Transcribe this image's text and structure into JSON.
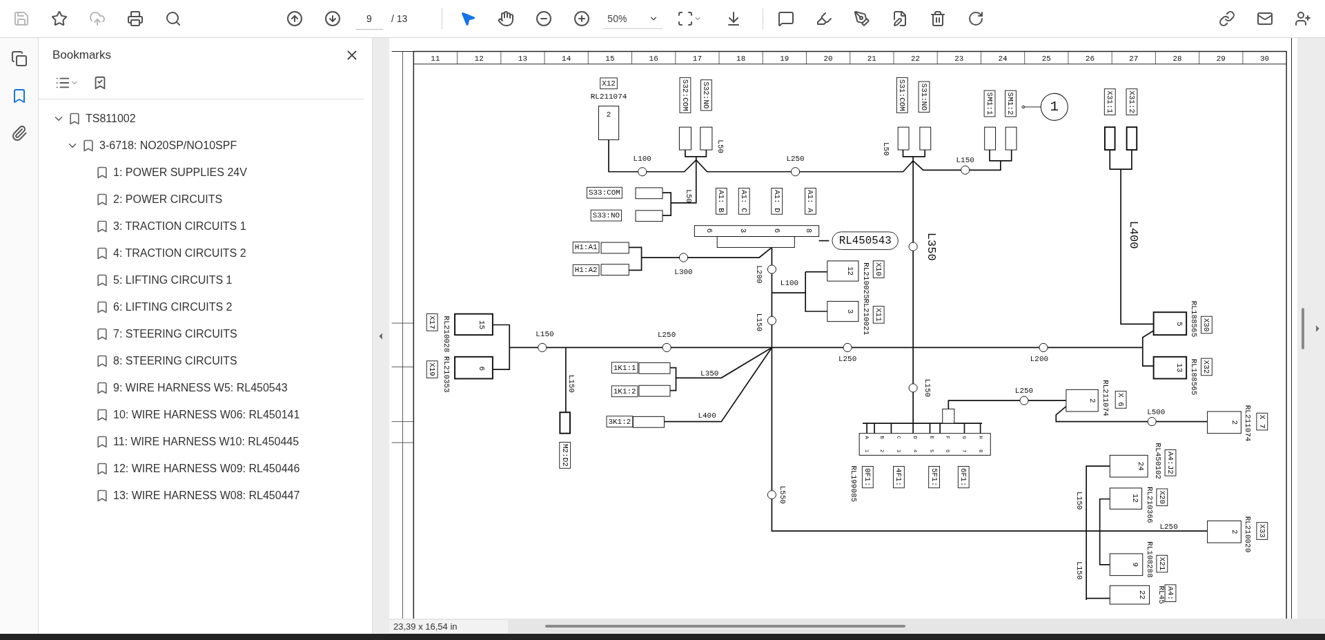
{
  "toolbar": {
    "page_number": "9",
    "page_total": "/ 13",
    "zoom": "50%"
  },
  "side_tabs": [
    {
      "kind": "pages",
      "selected": false
    },
    {
      "kind": "bookmarks",
      "selected": true
    },
    {
      "kind": "attachments",
      "selected": false
    }
  ],
  "bookmarks": {
    "title": "Bookmarks",
    "items": [
      {
        "label": "TS811002",
        "expanded": true,
        "children": [
          {
            "label": "3-6718: NO20SP/NO10SPF",
            "expanded": true,
            "children": [
              {
                "label": "1: POWER SUPPLIES 24V"
              },
              {
                "label": "2: POWER CIRCUITS"
              },
              {
                "label": "3: TRACTION CIRCUITS 1"
              },
              {
                "label": "4: TRACTION CIRCUITS 2"
              },
              {
                "label": "5: LIFTING CIRCUITS 1"
              },
              {
                "label": "6: LIFTING CIRCUITS 2"
              },
              {
                "label": "7: STEERING CIRCUITS"
              },
              {
                "label": "8: STEERING CIRCUITS"
              },
              {
                "label": "9: WIRE HARNESS W5: RL450543"
              },
              {
                "label": "10: WIRE HARNESS W06: RL450141"
              },
              {
                "label": "11: WIRE HARNESS W10: RL450445"
              },
              {
                "label": "12: WIRE HARNESS W09: RL450446"
              },
              {
                "label": "13: WIRE HARNESS W08: RL450447"
              }
            ]
          }
        ]
      }
    ]
  },
  "diagram": {
    "columns": [
      "11",
      "12",
      "13",
      "14",
      "15",
      "16",
      "17",
      "18",
      "19",
      "20",
      "21",
      "22",
      "23",
      "24",
      "25",
      "26",
      "27",
      "28",
      "29",
      "30"
    ],
    "labels": [
      {
        "text": "X12",
        "kind": "tag"
      },
      {
        "text": "RL211074",
        "kind": "ref"
      },
      {
        "text": "2",
        "kind": "pin"
      },
      {
        "text": "S32:COM",
        "kind": "tag"
      },
      {
        "text": "S32:NO",
        "kind": "tag"
      },
      {
        "text": "L50",
        "kind": "length"
      },
      {
        "text": "L100",
        "kind": "length"
      },
      {
        "text": "L250",
        "kind": "length"
      },
      {
        "text": "S31:COM",
        "kind": "tag"
      },
      {
        "text": "S31:NO",
        "kind": "tag"
      },
      {
        "text": "L50",
        "kind": "length"
      },
      {
        "text": "SM1:1",
        "kind": "tag"
      },
      {
        "text": "SM1:2",
        "kind": "tag"
      },
      {
        "text": "1",
        "kind": "circle"
      },
      {
        "text": "L150",
        "kind": "length"
      },
      {
        "text": "X31:1",
        "kind": "tag"
      },
      {
        "text": "X31:2",
        "kind": "tag"
      },
      {
        "text": "S33:COM",
        "kind": "tag"
      },
      {
        "text": "S33:NO",
        "kind": "tag"
      },
      {
        "text": "L50",
        "kind": "length"
      },
      {
        "text": "A1: B",
        "kind": "tag"
      },
      {
        "text": "A1: C",
        "kind": "tag"
      },
      {
        "text": "A1: D",
        "kind": "tag"
      },
      {
        "text": "A1: A",
        "kind": "tag"
      },
      {
        "text": "6",
        "kind": "pin"
      },
      {
        "text": "3",
        "kind": "pin"
      },
      {
        "text": "6",
        "kind": "pin"
      },
      {
        "text": "8",
        "kind": "pin"
      },
      {
        "text": "RL450543",
        "kind": "bubble"
      },
      {
        "text": "L350",
        "kind": "large"
      },
      {
        "text": "L400",
        "kind": "large"
      },
      {
        "text": "H1:A1",
        "kind": "tag"
      },
      {
        "text": "H1:A2",
        "kind": "tag"
      },
      {
        "text": "L300",
        "kind": "length"
      },
      {
        "text": "L200",
        "kind": "length"
      },
      {
        "text": "12",
        "kind": "pin"
      },
      {
        "text": "X10",
        "kind": "tag"
      },
      {
        "text": "RL210025RL210021",
        "kind": "ref"
      },
      {
        "text": "L100",
        "kind": "length"
      },
      {
        "text": "3",
        "kind": "pin"
      },
      {
        "text": "X11",
        "kind": "tag"
      },
      {
        "text": "L150",
        "kind": "length"
      },
      {
        "text": "X17",
        "kind": "tag"
      },
      {
        "text": "RL210028",
        "kind": "ref"
      },
      {
        "text": "15",
        "kind": "pin"
      },
      {
        "text": "6",
        "kind": "pin"
      },
      {
        "text": "X19",
        "kind": "tag"
      },
      {
        "text": "RL210353",
        "kind": "ref"
      },
      {
        "text": "L150",
        "kind": "length"
      },
      {
        "text": "L250",
        "kind": "length"
      },
      {
        "text": "L200",
        "kind": "length"
      },
      {
        "text": "L250",
        "kind": "length"
      },
      {
        "text": "RL188565",
        "kind": "ref"
      },
      {
        "text": "5",
        "kind": "pin"
      },
      {
        "text": "X30",
        "kind": "tag"
      },
      {
        "text": "13",
        "kind": "pin"
      },
      {
        "text": "X32",
        "kind": "tag"
      },
      {
        "text": "RL188565",
        "kind": "ref"
      },
      {
        "text": "1K1:1",
        "kind": "tag"
      },
      {
        "text": "1K1:2",
        "kind": "tag"
      },
      {
        "text": "L350",
        "kind": "length"
      },
      {
        "text": "L150",
        "kind": "length"
      },
      {
        "text": "3K1:2",
        "kind": "tag"
      },
      {
        "text": "L400",
        "kind": "length"
      },
      {
        "text": "M2:D2",
        "kind": "tag"
      },
      {
        "text": "L150",
        "kind": "length"
      },
      {
        "text": "L250",
        "kind": "length"
      },
      {
        "text": "RL211074",
        "kind": "ref"
      },
      {
        "text": "2",
        "kind": "pin"
      },
      {
        "text": "X 6",
        "kind": "tag"
      },
      {
        "text": "L500",
        "kind": "length"
      },
      {
        "text": "2",
        "kind": "pin"
      },
      {
        "text": "RL211074",
        "kind": "ref"
      },
      {
        "text": "X 7",
        "kind": "tag"
      },
      {
        "text": "A",
        "kind": "mini"
      },
      {
        "text": "B",
        "kind": "mini"
      },
      {
        "text": "C",
        "kind": "mini"
      },
      {
        "text": "D",
        "kind": "mini"
      },
      {
        "text": "E",
        "kind": "mini"
      },
      {
        "text": "F",
        "kind": "mini"
      },
      {
        "text": "G",
        "kind": "mini"
      },
      {
        "text": "H",
        "kind": "mini"
      },
      {
        "text": "1",
        "kind": "mini"
      },
      {
        "text": "2",
        "kind": "mini"
      },
      {
        "text": "3",
        "kind": "mini"
      },
      {
        "text": "4",
        "kind": "mini"
      },
      {
        "text": "5",
        "kind": "mini"
      },
      {
        "text": "6",
        "kind": "mini"
      },
      {
        "text": "7",
        "kind": "mini"
      },
      {
        "text": "8",
        "kind": "mini"
      },
      {
        "text": "0F1:",
        "kind": "tag"
      },
      {
        "text": "4F1:",
        "kind": "tag"
      },
      {
        "text": "5F1:",
        "kind": "tag"
      },
      {
        "text": "6F1:",
        "kind": "tag"
      },
      {
        "text": "RL199085",
        "kind": "ref"
      },
      {
        "text": "L550",
        "kind": "length"
      },
      {
        "text": "24",
        "kind": "pin"
      },
      {
        "text": "RL450102",
        "kind": "ref"
      },
      {
        "text": "A4:J2",
        "kind": "tag"
      },
      {
        "text": "12",
        "kind": "pin"
      },
      {
        "text": "RL210366",
        "kind": "ref"
      },
      {
        "text": "X20",
        "kind": "tag"
      },
      {
        "text": "L150",
        "kind": "length"
      },
      {
        "text": "L250",
        "kind": "length"
      },
      {
        "text": "2",
        "kind": "pin"
      },
      {
        "text": "RL210020",
        "kind": "ref"
      },
      {
        "text": "X33",
        "kind": "tag"
      },
      {
        "text": "9",
        "kind": "pin"
      },
      {
        "text": "RL108288",
        "kind": "ref"
      },
      {
        "text": "X21",
        "kind": "tag"
      },
      {
        "text": "L150",
        "kind": "length"
      },
      {
        "text": "22",
        "kind": "pin"
      },
      {
        "text": "RL45",
        "kind": "ref"
      },
      {
        "text": "A4:",
        "kind": "tag"
      }
    ]
  },
  "status_bar": {
    "page_size": "23,39 x 16,54 in"
  }
}
